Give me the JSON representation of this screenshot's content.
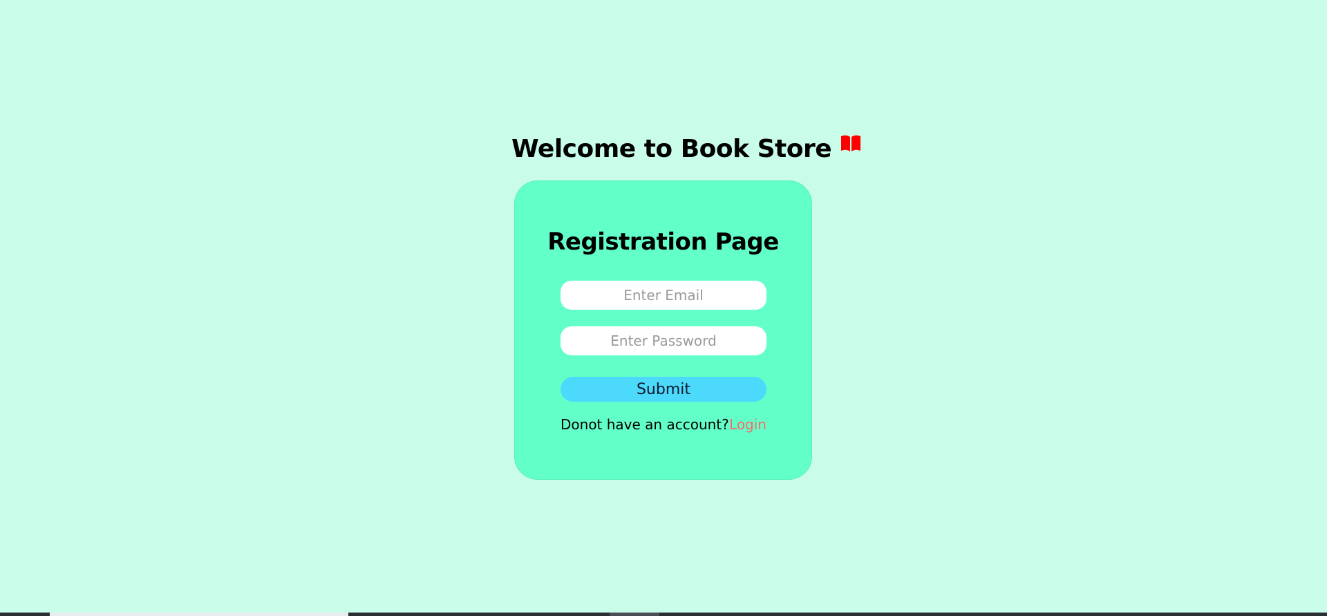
{
  "header": {
    "title": "Welcome to Book Store",
    "icon": "open-book-icon",
    "icon_color": "#ff0000"
  },
  "form": {
    "title": "Registration Page",
    "email_placeholder": "Enter Email",
    "email_value": "",
    "password_placeholder": "Enter Password",
    "password_value": "",
    "submit_label": "Submit",
    "account_prompt": "Donot have an account?",
    "login_link": "Login"
  },
  "colors": {
    "background": "#c9fdea",
    "card": "#63ffc9",
    "submit": "#4cd9fb",
    "link": "#f56b6b"
  }
}
